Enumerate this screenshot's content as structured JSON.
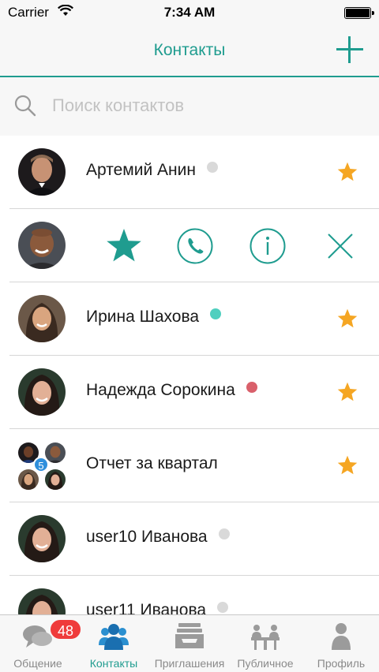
{
  "status_bar": {
    "carrier": "Carrier",
    "time": "7:34 AM"
  },
  "nav": {
    "title": "Контакты"
  },
  "search": {
    "placeholder": "Поиск контактов"
  },
  "contacts": [
    {
      "name": "Артемий Анин",
      "status": "offline",
      "status_color": "#d9d9d9",
      "favorite": true
    },
    {
      "name": "",
      "swiped": true,
      "actions": [
        "star-icon",
        "phone-icon",
        "info-icon",
        "close-icon"
      ]
    },
    {
      "name": "Ирина Шахова",
      "status": "online",
      "status_color": "#4fcfbf",
      "favorite": true
    },
    {
      "name": "Надежда Сорокина",
      "status": "busy",
      "status_color": "#d9606b",
      "favorite": true
    },
    {
      "name": "Отчет за квартал",
      "group": true,
      "group_count": "5",
      "favorite": true
    },
    {
      "name": "user10 Иванова",
      "status": "offline",
      "status_color": "#d9d9d9",
      "favorite": false
    },
    {
      "name": "user11 Иванова",
      "status": "offline",
      "status_color": "#d9d9d9",
      "favorite": false
    }
  ],
  "tabs": [
    {
      "label": "Общение",
      "icon": "chat-icon",
      "badge": "48"
    },
    {
      "label": "Контакты",
      "icon": "contacts-icon",
      "active": true
    },
    {
      "label": "Приглашения",
      "icon": "inbox-icon"
    },
    {
      "label": "Публичное",
      "icon": "public-meeting-icon"
    },
    {
      "label": "Профиль",
      "icon": "profile-icon"
    }
  ],
  "colors": {
    "accent": "#1f9c8f",
    "star_favorite": "#f5a623",
    "badge": "#ef3b3b",
    "online": "#4fcfbf",
    "busy": "#d9606b",
    "offline": "#d9d9d9"
  }
}
